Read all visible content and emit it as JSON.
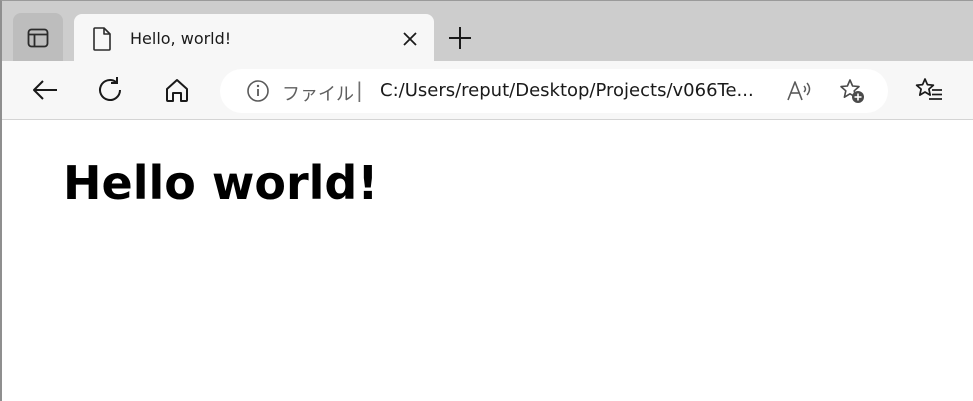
{
  "tab": {
    "title": "Hello, world!"
  },
  "addressbar": {
    "scheme_label": "ファイル",
    "separator": "|",
    "url": "C:/Users/reput/Desktop/Projects/v066Te..."
  },
  "page": {
    "heading": "Hello world!"
  },
  "icons": {
    "tab_actions": "tab-actions-icon",
    "page": "page-icon",
    "close": "close-icon",
    "new_tab": "plus-icon",
    "back": "arrow-left-icon",
    "refresh": "refresh-icon",
    "home": "home-icon",
    "info": "info-icon",
    "read_aloud": "read-aloud-icon",
    "add_favorite": "star-plus-icon",
    "favorites": "favorites-list-icon"
  },
  "colors": {
    "tabstrip": "#cdcdcd",
    "toolbar": "#f7f7f7",
    "address_bg": "#ffffff",
    "text": "#1a1a1a"
  }
}
